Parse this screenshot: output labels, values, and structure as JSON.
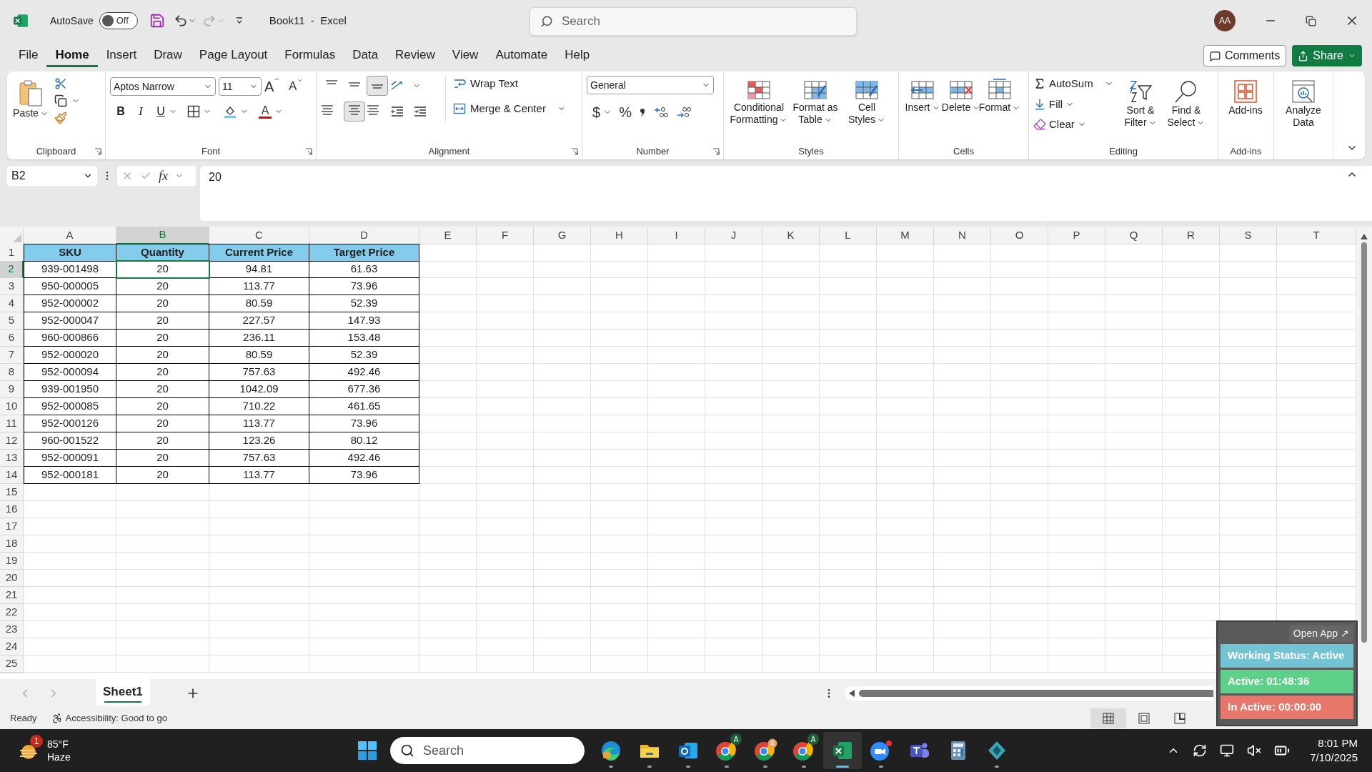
{
  "title_bar": {
    "autosave_label": "AutoSave",
    "autosave_toggle": {
      "label": "Off",
      "on": false
    },
    "document_title": "Book11  -  Excel",
    "search": {
      "placeholder": "Search"
    },
    "avatar": "AA"
  },
  "menu_tabs": [
    {
      "label": "File",
      "selected": false
    },
    {
      "label": "Home",
      "selected": true
    },
    {
      "label": "Insert",
      "selected": false
    },
    {
      "label": "Draw",
      "selected": false
    },
    {
      "label": "Page Layout",
      "selected": false
    },
    {
      "label": "Formulas",
      "selected": false
    },
    {
      "label": "Data",
      "selected": false
    },
    {
      "label": "Review",
      "selected": false
    },
    {
      "label": "View",
      "selected": false
    },
    {
      "label": "Automate",
      "selected": false
    },
    {
      "label": "Help",
      "selected": false
    }
  ],
  "comments_button": "Comments",
  "share_button": "Share",
  "ribbon": {
    "clipboard": {
      "title": "Clipboard",
      "paste": "Paste"
    },
    "font": {
      "title": "Font",
      "font_name": "Aptos Narrow",
      "font_size": "11",
      "grow_glyph": "A",
      "shrink_glyph": "A",
      "bold": "B",
      "italic": "I",
      "underline": "U",
      "color_glyph": "A"
    },
    "alignment": {
      "title": "Alignment",
      "wrap_text": "Wrap Text",
      "merge_center": "Merge & Center"
    },
    "number": {
      "title": "Number",
      "format": "General",
      "currency": "$",
      "percent": "%"
    },
    "styles": {
      "title": "Styles",
      "buttons": [
        {
          "lines": [
            "Conditional",
            "Formatting"
          ]
        },
        {
          "lines": [
            "Format as",
            "Table"
          ]
        },
        {
          "lines": [
            "Cell",
            "Styles"
          ]
        }
      ]
    },
    "cells": {
      "title": "Cells",
      "buttons": [
        "Insert",
        "Delete",
        "Format"
      ]
    },
    "editing": {
      "title": "Editing",
      "autosum": "AutoSum",
      "fill": "Fill",
      "clear": "Clear",
      "sort_filter": [
        "Sort &",
        "Filter"
      ],
      "find_select": [
        "Find &",
        "Select"
      ]
    },
    "addins": {
      "title": "Add-ins",
      "button": "Add-ins"
    },
    "analyze": {
      "lines": [
        "Analyze",
        "Data"
      ]
    }
  },
  "formula_bar": {
    "name_box": "B2",
    "function_glyph": "fx",
    "formula": "20"
  },
  "sheet": {
    "columns": [
      {
        "label": "A",
        "selected": false
      },
      {
        "label": "B",
        "selected": true
      },
      {
        "label": "C",
        "selected": false
      },
      {
        "label": "D",
        "selected": false
      },
      {
        "label": "E",
        "selected": false
      },
      {
        "label": "F",
        "selected": false
      },
      {
        "label": "G",
        "selected": false
      },
      {
        "label": "H",
        "selected": false
      },
      {
        "label": "I",
        "selected": false
      },
      {
        "label": "J",
        "selected": false
      },
      {
        "label": "K",
        "selected": false
      },
      {
        "label": "L",
        "selected": false
      },
      {
        "label": "M",
        "selected": false
      },
      {
        "label": "N",
        "selected": false
      },
      {
        "label": "O",
        "selected": false
      },
      {
        "label": "P",
        "selected": false
      },
      {
        "label": "Q",
        "selected": false
      },
      {
        "label": "R",
        "selected": false
      },
      {
        "label": "S",
        "selected": false
      },
      {
        "label": "T",
        "selected": false
      }
    ],
    "rows": [
      {
        "label": "1",
        "selected": false,
        "kind": "header",
        "cells": [
          "SKU",
          "Quantity",
          "Current Price",
          "Target Price"
        ]
      },
      {
        "label": "2",
        "selected": true,
        "kind": "data",
        "cells": [
          "939-001498",
          "20",
          "94.81",
          "61.63"
        ]
      },
      {
        "label": "3",
        "selected": false,
        "kind": "data",
        "cells": [
          "950-000005",
          "20",
          "113.77",
          "73.96"
        ]
      },
      {
        "label": "4",
        "selected": false,
        "kind": "data",
        "cells": [
          "952-000002",
          "20",
          "80.59",
          "52.39"
        ]
      },
      {
        "label": "5",
        "selected": false,
        "kind": "data",
        "cells": [
          "952-000047",
          "20",
          "227.57",
          "147.93"
        ]
      },
      {
        "label": "6",
        "selected": false,
        "kind": "data",
        "cells": [
          "960-000866",
          "20",
          "236.11",
          "153.48"
        ]
      },
      {
        "label": "7",
        "selected": false,
        "kind": "data",
        "cells": [
          "952-000020",
          "20",
          "80.59",
          "52.39"
        ]
      },
      {
        "label": "8",
        "selected": false,
        "kind": "data",
        "cells": [
          "952-000094",
          "20",
          "757.63",
          "492.46"
        ]
      },
      {
        "label": "9",
        "selected": false,
        "kind": "data",
        "cells": [
          "939-001950",
          "20",
          "1042.09",
          "677.36"
        ]
      },
      {
        "label": "10",
        "selected": false,
        "kind": "data",
        "cells": [
          "952-000085",
          "20",
          "710.22",
          "461.65"
        ]
      },
      {
        "label": "11",
        "selected": false,
        "kind": "data",
        "cells": [
          "952-000126",
          "20",
          "113.77",
          "73.96"
        ]
      },
      {
        "label": "12",
        "selected": false,
        "kind": "data",
        "cells": [
          "960-001522",
          "20",
          "123.26",
          "80.12"
        ]
      },
      {
        "label": "13",
        "selected": false,
        "kind": "data",
        "cells": [
          "952-000091",
          "20",
          "757.63",
          "492.46"
        ]
      },
      {
        "label": "14",
        "selected": false,
        "kind": "data",
        "cells": [
          "952-000181",
          "20",
          "113.77",
          "73.96"
        ]
      },
      {
        "label": "15",
        "selected": false,
        "kind": "empty"
      },
      {
        "label": "16",
        "selected": false,
        "kind": "empty"
      },
      {
        "label": "17",
        "selected": false,
        "kind": "empty"
      },
      {
        "label": "18",
        "selected": false,
        "kind": "empty"
      },
      {
        "label": "19",
        "selected": false,
        "kind": "empty"
      },
      {
        "label": "20",
        "selected": false,
        "kind": "empty"
      },
      {
        "label": "21",
        "selected": false,
        "kind": "empty"
      },
      {
        "label": "22",
        "selected": false,
        "kind": "empty"
      },
      {
        "label": "23",
        "selected": false,
        "kind": "empty"
      },
      {
        "label": "24",
        "selected": false,
        "kind": "empty"
      },
      {
        "label": "25",
        "selected": false,
        "kind": "empty"
      }
    ]
  },
  "sheet_tabs": [
    {
      "label": "Sheet1",
      "selected": true
    }
  ],
  "status_bar": {
    "status": "Ready",
    "accessibility": "Accessibility: Good to go",
    "views": [
      {
        "kind": "normal",
        "selected": true
      },
      {
        "kind": "page_layout",
        "selected": false
      },
      {
        "kind": "page_break",
        "selected": false
      }
    ]
  },
  "tracker_widget": {
    "open_button": "Open App ↗",
    "rows": [
      {
        "text": "Working Status: Active",
        "color": "#72c4d4"
      },
      {
        "text": "Active: 01:48:36",
        "color": "#5fd08a"
      },
      {
        "text": "In Active: 00:00:00",
        "color": "#e8776b"
      }
    ]
  },
  "taskbar": {
    "weather": {
      "badge": "1",
      "temperature": "85°F",
      "condition": "Haze"
    },
    "search": {
      "placeholder": "Search"
    },
    "apps": [
      {
        "kind": "edge",
        "running": true,
        "selected": false
      },
      {
        "kind": "explorer",
        "running": true,
        "selected": false
      },
      {
        "kind": "outlook",
        "running": true,
        "selected": false
      },
      {
        "kind": "chrome",
        "badge": "A",
        "running": true,
        "selected": false
      },
      {
        "kind": "chrome_profile",
        "running": true,
        "selected": false
      },
      {
        "kind": "chrome",
        "badge": "A",
        "running": true,
        "selected": false
      },
      {
        "kind": "excel",
        "running": true,
        "selected": true
      },
      {
        "kind": "zoom",
        "running": true,
        "selected": false
      },
      {
        "kind": "teams",
        "running": false,
        "selected": false
      },
      {
        "kind": "calculator",
        "running": false,
        "selected": false
      },
      {
        "kind": "diamond",
        "running": true,
        "selected": false
      }
    ],
    "time": "8:01 PM",
    "date": "7/10/2025"
  }
}
